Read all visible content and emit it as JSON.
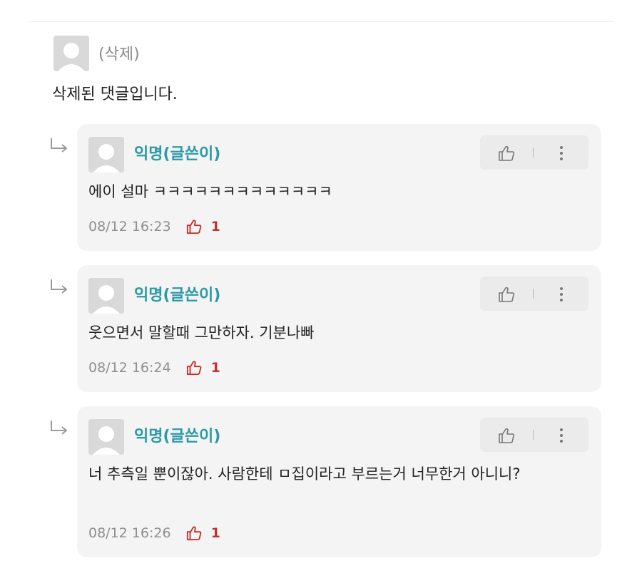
{
  "deleted_comment": {
    "name": "(삭제)",
    "body": "삭제된 댓글입니다."
  },
  "replies": [
    {
      "author": "익명(글쓴이)",
      "text": "에이 설마 ㅋㅋㅋㅋㅋㅋㅋㅋㅋㅋㅋㅋㅋ",
      "timestamp": "08/12 16:23",
      "likes": "1"
    },
    {
      "author": "익명(글쓴이)",
      "text": "웃으면서 말할때 그만하자. 기분나빠",
      "timestamp": "08/12 16:24",
      "likes": "1"
    },
    {
      "author": "익명(글쓴이)",
      "text": "너 추측일 뿐이잖아. 사람한테 ㅁ집이라고 부르는거 너무한거 아니니?",
      "timestamp": "08/12 16:26",
      "likes": "1"
    }
  ],
  "colors": {
    "author": "#2b9aa6",
    "like_count": "#c4302b",
    "card_bg": "#f4f4f4"
  },
  "icons": [
    "avatar-placeholder",
    "reply-arrow-icon",
    "thumbs-up-icon",
    "more-vertical-icon"
  ]
}
